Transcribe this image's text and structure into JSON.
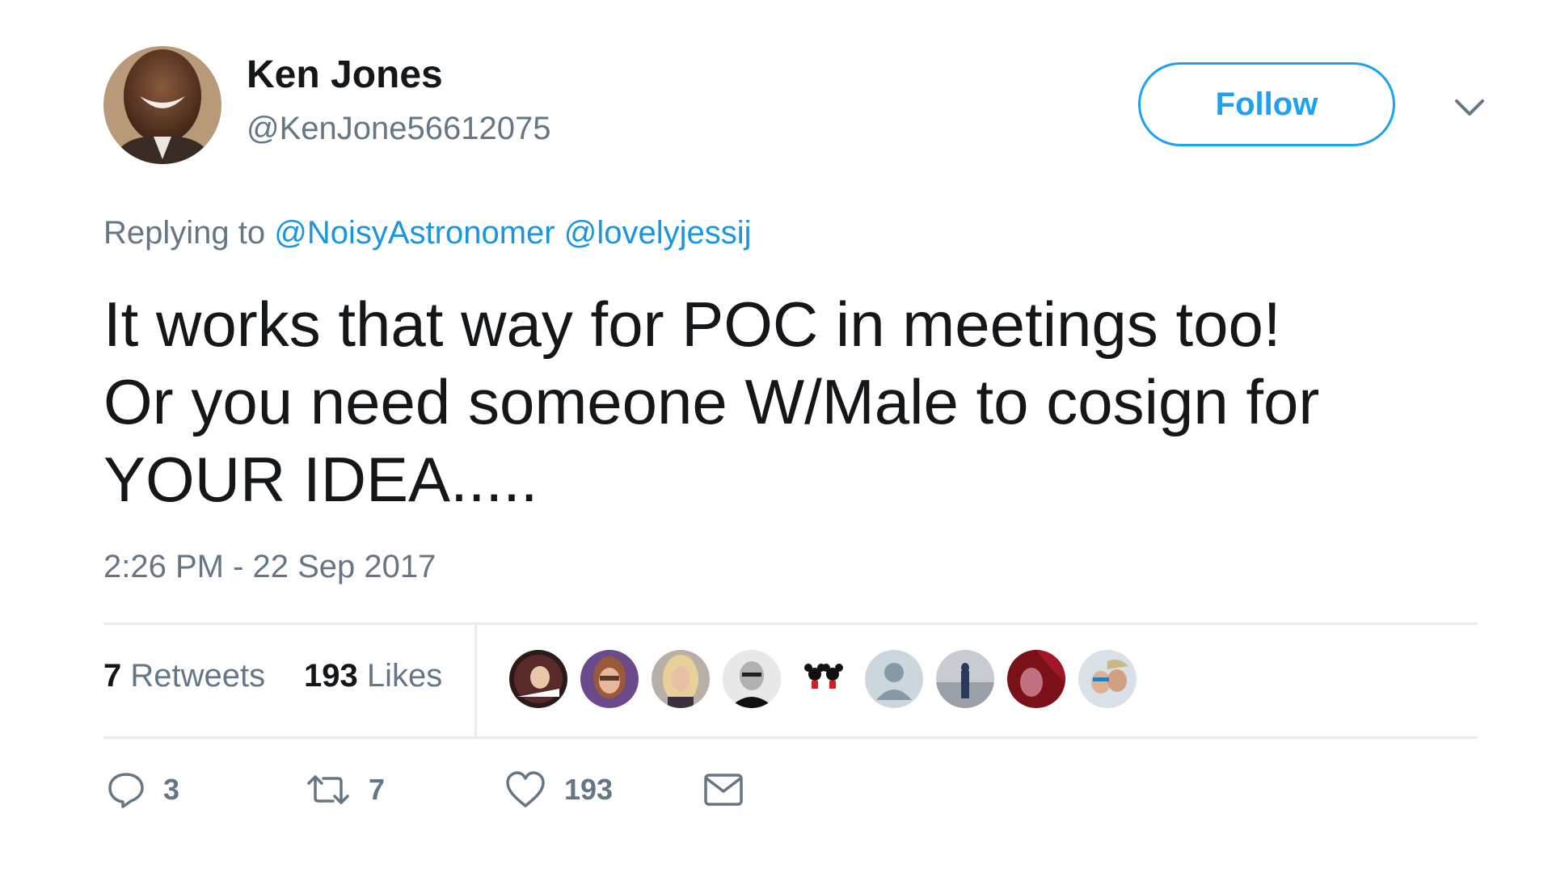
{
  "user": {
    "name": "Ken Jones",
    "handle": "@KenJone56612075",
    "avatar_icon": "profile-photo"
  },
  "follow_label": "Follow",
  "menu_icon": "chevron-down-icon",
  "reply": {
    "prefix": "Replying to",
    "mentions": [
      "@NoisyAstronomer",
      "@lovelyjessij"
    ]
  },
  "tweet": {
    "lines": [
      "It works that way for POC in meetings too!",
      "Or you need someone W/Male to cosign for",
      "YOUR IDEA....."
    ]
  },
  "timestamp": "2:26 PM - 22 Sep 2017",
  "stats": {
    "retweets_count": "7",
    "retweets_label": "Retweets",
    "likes_count": "193",
    "likes_label": "Likes"
  },
  "actions": {
    "reply_count": "3",
    "retweet_count": "7",
    "like_count": "193"
  },
  "colors": {
    "accent": "#1da1f2",
    "text": "#14171a",
    "secondary": "#657786",
    "border": "#e6ecf0"
  }
}
